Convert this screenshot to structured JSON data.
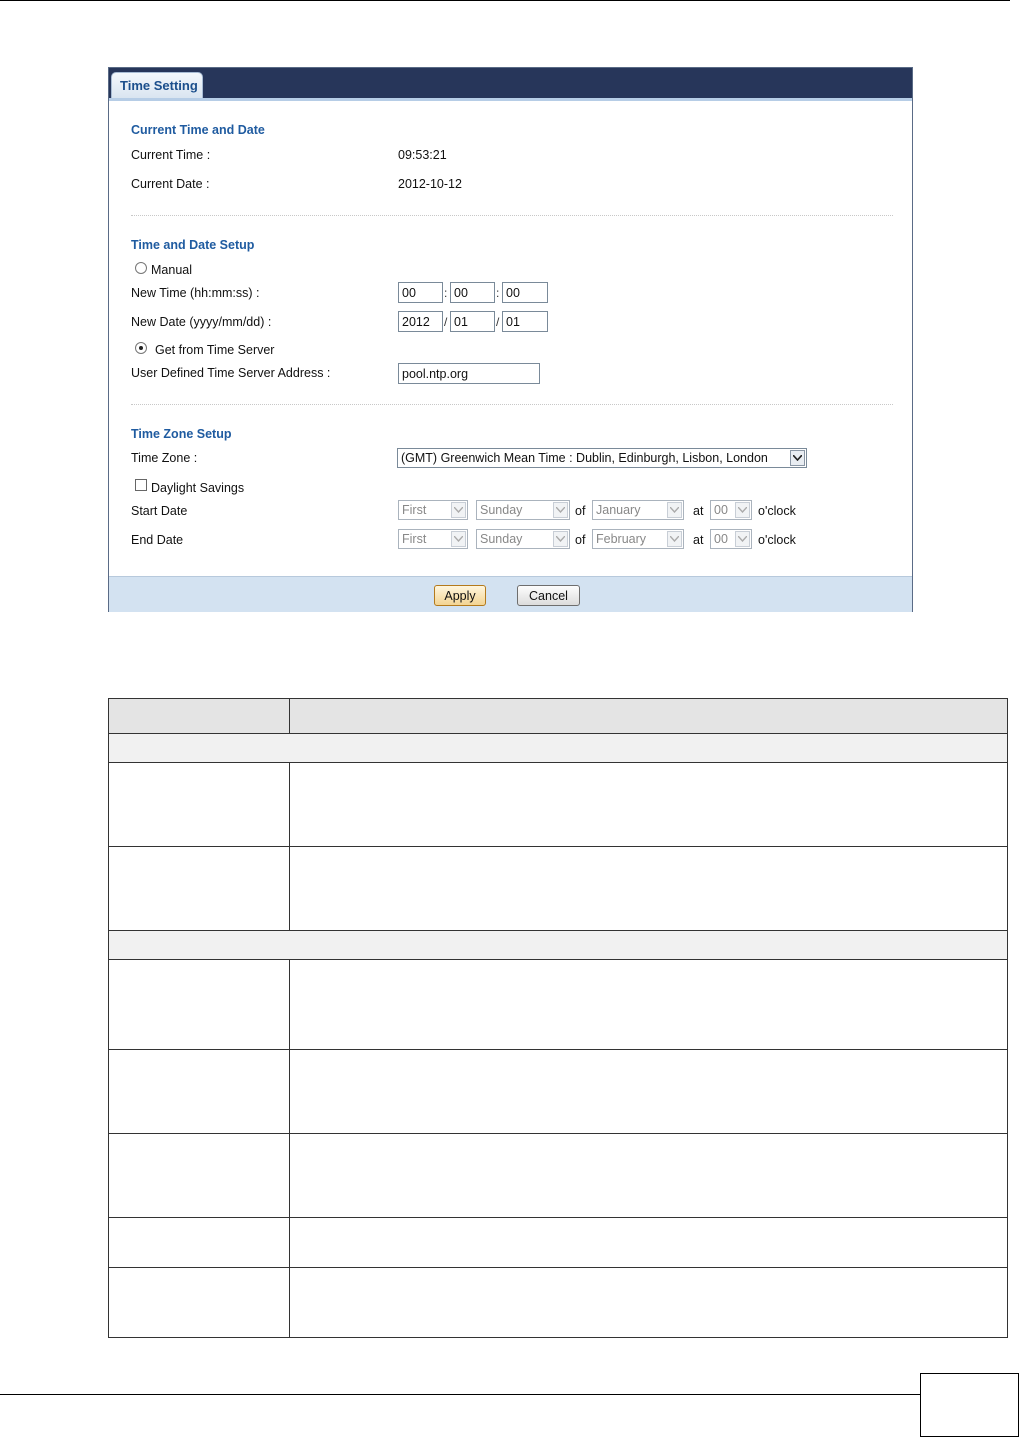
{
  "panel": {
    "tab_label": "Time Setting",
    "current": {
      "title": "Current Time and Date",
      "time_label": "Current Time :",
      "time_value": "09:53:21",
      "date_label": "Current Date :",
      "date_value": "2012-10-12"
    },
    "setup": {
      "title": "Time and Date Setup",
      "manual_label": "Manual",
      "new_time_label": "New Time (hh:mm:ss) :",
      "hh": "00",
      "mm": "00",
      "ss": "00",
      "new_date_label": "New Date (yyyy/mm/dd) :",
      "yyyy": "2012",
      "mo": "01",
      "dd": "01",
      "server_label": "Get from Time Server",
      "server_addr_label": "User Defined Time Server Address :",
      "server_addr": "pool.ntp.org",
      "colon": ":",
      "slash": "/"
    },
    "zone": {
      "title": "Time Zone Setup",
      "tz_label": "Time Zone :",
      "tz_value": "(GMT) Greenwich Mean Time : Dublin, Edinburgh, Lisbon, London",
      "dst_label": "Daylight Savings",
      "start_label": "Start Date",
      "start": {
        "week": "First",
        "day": "Sunday",
        "month": "January",
        "hour": "00"
      },
      "end_label": "End Date",
      "end": {
        "week": "First",
        "day": "Sunday",
        "month": "February",
        "hour": "00"
      },
      "of": "of",
      "at": "at",
      "oclock": "o'clock"
    },
    "buttons": {
      "apply": "Apply",
      "cancel": "Cancel"
    }
  }
}
